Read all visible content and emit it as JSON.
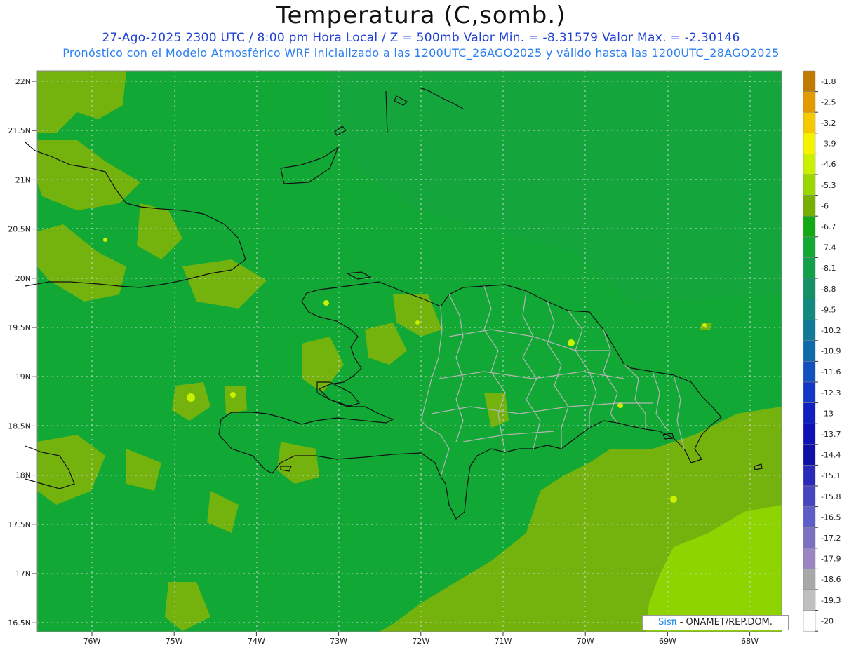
{
  "header": {
    "title": "Temperatura (C,somb.)",
    "line1": "27-Ago-2025  2300 UTC / 8:00 pm Hora Local / Z = 500mb  Valor Min. = -8.31579  Valor Max. = -2.30146",
    "line2": "Pronóstico con el Modelo Atmosférico WRF inicializado a las 1200UTC_26AGO2025 y válido hasta las  1200UTC_28AGO2025"
  },
  "lat_labels": [
    "22N",
    "21.5N",
    "21N",
    "20.5N",
    "20N",
    "19.5N",
    "19N",
    "18.5N",
    "18N",
    "17.5N",
    "17N",
    "16.5N"
  ],
  "lon_labels": [
    "76W",
    "75W",
    "74W",
    "73W",
    "72W",
    "71W",
    "70W",
    "69W",
    "68W"
  ],
  "colorbar": {
    "labels": [
      "-1.8",
      "-2.5",
      "-3.2",
      "-3.9",
      "-4.6",
      "-5.3",
      "-6",
      "-6.7",
      "-7.4",
      "-8.1",
      "-8.8",
      "-9.5",
      "-10.2",
      "-10.9",
      "-11.6",
      "-12.3",
      "-13",
      "-13.7",
      "-14.4",
      "-15.1",
      "-15.8",
      "-16.5",
      "-17.2",
      "-17.9",
      "-18.6",
      "-19.3",
      "-20"
    ],
    "colors": [
      "#c07a00",
      "#e39a00",
      "#f6c800",
      "#f6f300",
      "#c8f000",
      "#9ad600",
      "#77b000",
      "#12aa12",
      "#14a834",
      "#12a04a",
      "#139066",
      "#128a80",
      "#117a96",
      "#0f6aaa",
      "#1250c0",
      "#1238c8",
      "#1020c0",
      "#1010b8",
      "#1010a8",
      "#2a2ab8",
      "#4646c0",
      "#5e5ec8",
      "#7a72c0",
      "#9a86c0",
      "#a8a8a8",
      "#c0c0c0",
      "#ffffff"
    ]
  },
  "credit": {
    "brand": "Sisπ",
    "text": " - ONAMET/REP.DOM."
  },
  "colors": {
    "field_main": "#12a836",
    "field_north": "#15a43c",
    "field_light": "#74b20d",
    "field_bright": "#8ed400",
    "coast": "#111111",
    "province": "#b4b4b4",
    "grid": "#d8d8d8"
  }
}
